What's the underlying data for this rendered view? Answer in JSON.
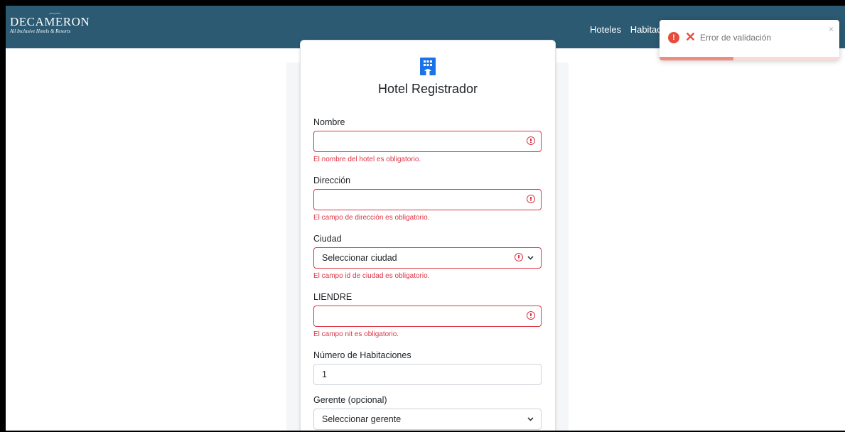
{
  "brand": {
    "name": "DECAMERON",
    "tagline": "All Inclusive Hotels & Resorts"
  },
  "nav": {
    "items": [
      "Hoteles",
      "Habitac"
    ]
  },
  "form": {
    "title": "Hotel Registrador",
    "icon": "hotel-building-icon",
    "fields": {
      "nombre": {
        "label": "Nombre",
        "value": "",
        "error": "El nombre del hotel es obligatorio."
      },
      "direccion": {
        "label": "Dirección",
        "value": "",
        "error": "El campo de dirección es obligatorio."
      },
      "ciudad": {
        "label": "Ciudad",
        "selected": "Seleccionar ciudad",
        "error": "El campo id de ciudad es obligatorio."
      },
      "nit": {
        "label": "LIENDRE",
        "value": "",
        "error": "El campo nit es obligatorio."
      },
      "habitaciones": {
        "label": "Número de Habitaciones",
        "value": "1"
      },
      "gerente": {
        "label": "Gerente (opcional)",
        "selected": "Seleccionar gerente"
      }
    }
  },
  "toast": {
    "message": "Error de validación",
    "close": "×",
    "icon": "alert-circle-icon",
    "progress": 0.41
  },
  "colors": {
    "navbar": "#2c5a73",
    "error": "#dc3545",
    "accent": "#1a73e8",
    "toast_error": "#e74c3c"
  }
}
